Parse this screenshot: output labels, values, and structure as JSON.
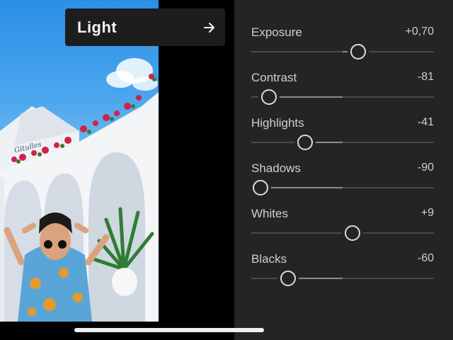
{
  "header": {
    "title": "Light",
    "next_icon": "arrow-right-icon"
  },
  "photo": {
    "sign_text": "Gitulles"
  },
  "adjustments": [
    {
      "label": "Exposure",
      "value": "+0,70",
      "level": 0.585,
      "center": 0.5
    },
    {
      "label": "Contrast",
      "value": "-81",
      "level": 0.095,
      "center": 0.5
    },
    {
      "label": "Highlights",
      "value": "-41",
      "level": 0.295,
      "center": 0.5
    },
    {
      "label": "Shadows",
      "value": "-90",
      "level": 0.05,
      "center": 0.5
    },
    {
      "label": "Whites",
      "value": "+9",
      "level": 0.555,
      "center": 0.5
    },
    {
      "label": "Blacks",
      "value": "-60",
      "level": 0.2,
      "center": 0.5
    }
  ],
  "colors": {
    "panel": "#242424",
    "pill": "#1d1d1d",
    "sky": "#2b8fe6"
  }
}
